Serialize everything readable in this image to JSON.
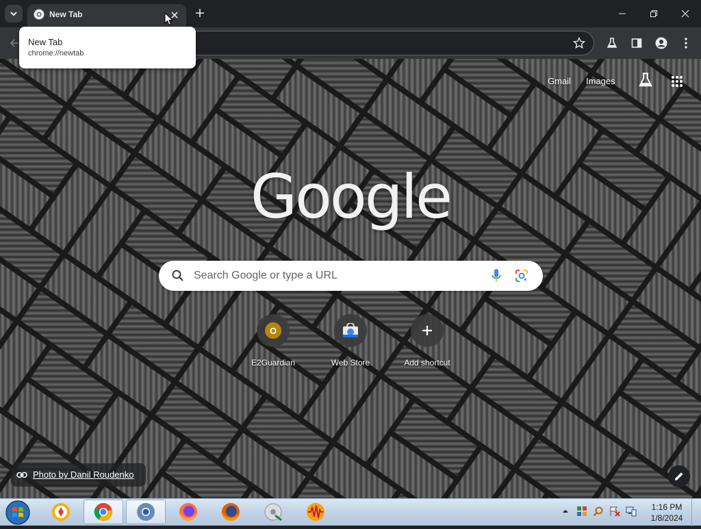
{
  "browser": {
    "tab": {
      "title": "New Tab"
    },
    "tooltip": {
      "title": "New Tab",
      "url": "chrome://newtab"
    }
  },
  "ntp": {
    "top_links": {
      "gmail": "Gmail",
      "images": "Images"
    },
    "logo_text": "Google",
    "search_placeholder": "Search Google or type a URL",
    "shortcuts": [
      {
        "label": "E2Guardian",
        "initial": "O"
      },
      {
        "label": "Web Store"
      },
      {
        "label": "Add shortcut"
      }
    ],
    "attribution": "Photo by Danil Roudenko"
  },
  "taskbar": {
    "clock_time": "1:16 PM",
    "clock_date": "1/8/2024"
  },
  "colors": {
    "browser_frame": "#202124",
    "toolbar": "#35363a",
    "e2guardian_badge": "#b8860b",
    "taskbar": "#c3d3e6"
  },
  "icons": {
    "tab_search": "chevron-down-icon",
    "favicon": "chrome-icon",
    "close": "close-icon",
    "new_tab": "plus-icon",
    "minimize": "minimize-icon",
    "restore": "restore-icon",
    "window_close": "close-icon",
    "back": "arrow-left-icon",
    "bookmark": "star-icon",
    "labs": "flask-icon",
    "side_panel": "side-panel-icon",
    "profile": "profile-icon",
    "menu": "kebab-icon",
    "apps": "grid-icon",
    "search": "magnifier-icon",
    "voice": "mic-icon",
    "lens": "lens-icon",
    "customize": "pencil-icon",
    "link": "link-icon"
  }
}
